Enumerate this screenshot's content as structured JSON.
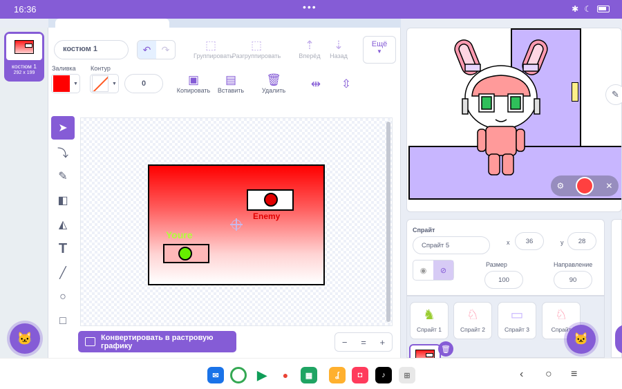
{
  "status_bar": {
    "time": "16:36",
    "dots": "•••",
    "icons": [
      "bluetooth-icon",
      "moon-icon",
      "battery-icon"
    ]
  },
  "costumes": [
    {
      "number": "1",
      "name": "костюм 1",
      "size": "292 x 199"
    }
  ],
  "toolbar": {
    "costume_name": "костюм 1",
    "group_label": "Группировать",
    "ungroup_label": "Разгруппировать",
    "forward_label": "Вперёд",
    "backward_label": "Назад",
    "more_label": "Ещё",
    "fill_label": "Заливка",
    "outline_label": "Контур",
    "outline_width": "0",
    "copy_label": "Копировать",
    "paste_label": "Вставить",
    "delete_label": "Удалить"
  },
  "colors": {
    "accent": "#855cd6",
    "fill": "#ff0000",
    "outline_stroke": "#ff5a24"
  },
  "canvas": {
    "enemy_label": "Enemy",
    "youre_label": "Youre"
  },
  "convert_button": "Конвертировать в растровую графику",
  "zoom": {
    "out": "−",
    "reset": "=",
    "in": "+"
  },
  "sprite_info": {
    "heading": "Спрайт",
    "name": "Спрайт 5",
    "x_label": "x",
    "x": "36",
    "y_label": "y",
    "y": "28",
    "size_label": "Размер",
    "size": "100",
    "direction_label": "Направление",
    "direction": "90"
  },
  "sprites": [
    {
      "name": "Спрайт 1"
    },
    {
      "name": "Спрайт 2"
    },
    {
      "name": "Спрайт 3"
    },
    {
      "name": "Спрайт"
    }
  ]
}
